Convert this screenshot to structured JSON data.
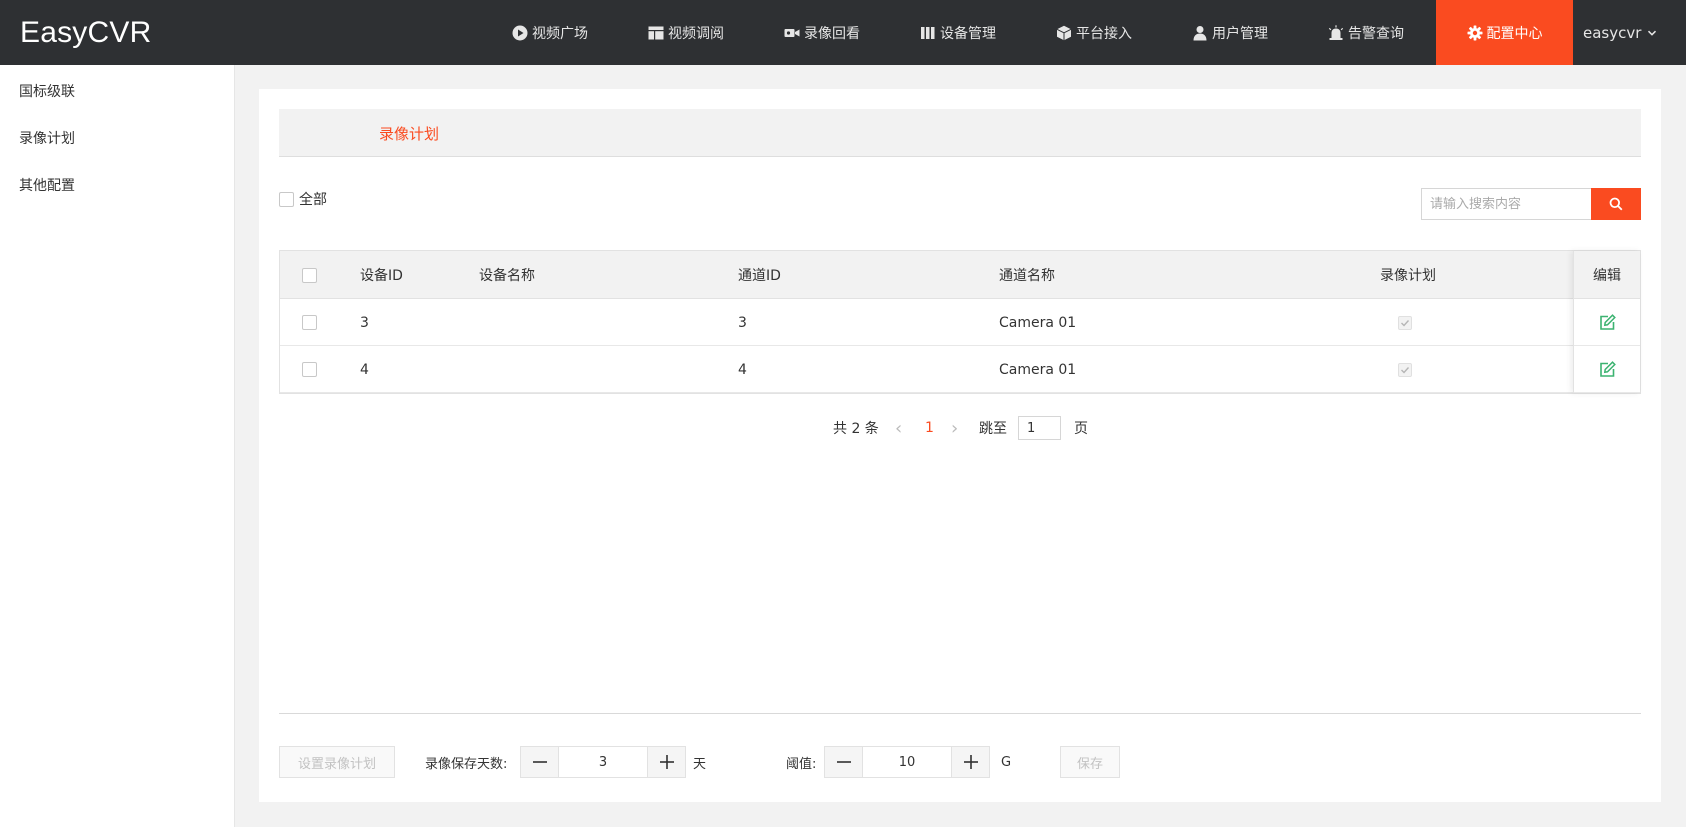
{
  "header": {
    "logo": "EasyCVR",
    "nav": [
      {
        "label": "视频广场",
        "icon": "play-circle-icon"
      },
      {
        "label": "视频调阅",
        "icon": "layout-icon"
      },
      {
        "label": "录像回看",
        "icon": "video-camera-icon"
      },
      {
        "label": "设备管理",
        "icon": "columns-icon"
      },
      {
        "label": "平台接入",
        "icon": "cube-icon"
      },
      {
        "label": "用户管理",
        "icon": "user-icon"
      },
      {
        "label": "告警查询",
        "icon": "alarm-icon"
      },
      {
        "label": "配置中心",
        "icon": "gear-icon",
        "active": true
      }
    ],
    "user": "easycvr"
  },
  "sidebar": {
    "items": [
      {
        "label": "国标级联"
      },
      {
        "label": "录像计划"
      },
      {
        "label": "其他配置"
      }
    ]
  },
  "main": {
    "tab": "录像计划",
    "select_all_label": "全部",
    "search": {
      "placeholder": "请输入搜索内容"
    },
    "table": {
      "columns": [
        "设备ID",
        "设备名称",
        "通道ID",
        "通道名称",
        "录像计划",
        "编辑"
      ],
      "rows": [
        {
          "device_id": "3",
          "device_name": "",
          "channel_id": "3",
          "channel_name": "Camera 01",
          "plan": true
        },
        {
          "device_id": "4",
          "device_name": "",
          "channel_id": "4",
          "channel_name": "Camera 01",
          "plan": true
        }
      ]
    },
    "pagination": {
      "total_label": "共 2 条",
      "prev": "‹",
      "current_page": "1",
      "next": "›",
      "jump_label": "跳至",
      "jump_value": "1",
      "page_label": "页"
    },
    "footer": {
      "set_plan_button": "设置录像计划",
      "retention_label": "录像保存天数:",
      "retention_value": "3",
      "retention_unit": "天",
      "threshold_label": "阈值:",
      "threshold_value": "10",
      "threshold_unit": "G",
      "save_button": "保存"
    }
  },
  "colors": {
    "accent": "#fa4b20",
    "topbar": "#2e3033",
    "edit_icon": "#3cb371"
  }
}
